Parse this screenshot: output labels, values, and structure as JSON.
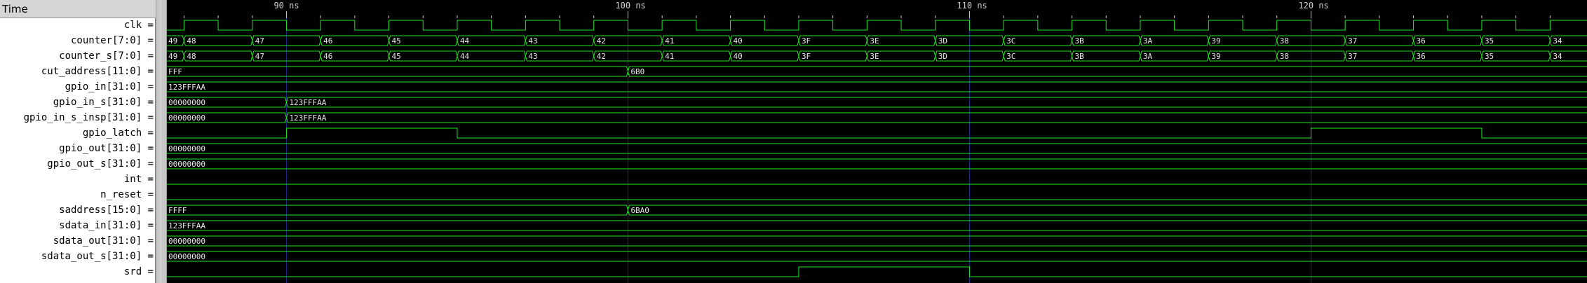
{
  "time_header": "Time",
  "time_ticks": [
    {
      "t": 90,
      "label": "90 ns"
    },
    {
      "t": 100,
      "label": "100 ns"
    },
    {
      "t": 110,
      "label": "110 ns"
    },
    {
      "t": 120,
      "label": "120 ns"
    }
  ],
  "view": {
    "t_start": 86.5,
    "t_end": 127.6
  },
  "colors": {
    "trace": "#22e622",
    "grid": "#1e2a8a",
    "tick": "#c8c8c8",
    "text": "#e8e8e8"
  },
  "signals": [
    {
      "name": "clk",
      "kind": "clock",
      "period": 2,
      "high_start": 87,
      "t_end": 127.6
    },
    {
      "name": "counter[7:0]",
      "kind": "counter",
      "start_value": 73,
      "first_change": 87,
      "step": 2,
      "radix": "hex",
      "t_end": 127.6
    },
    {
      "name": "counter_s[7:0]",
      "kind": "counter",
      "start_value": 73,
      "first_change": 87,
      "step": 2,
      "radix": "hex",
      "t_end": 127.6
    },
    {
      "name": "cut_address[11:0]",
      "kind": "bus",
      "segments": [
        {
          "t": 86.5,
          "v": "FFF"
        },
        {
          "t": 100,
          "v": "6B0"
        }
      ]
    },
    {
      "name": "gpio_in[31:0]",
      "kind": "bus",
      "segments": [
        {
          "t": 86.5,
          "v": "123FFFAA"
        }
      ]
    },
    {
      "name": "gpio_in_s[31:0]",
      "kind": "bus",
      "segments": [
        {
          "t": 86.5,
          "v": "00000000"
        },
        {
          "t": 90,
          "v": "123FFFAA"
        }
      ]
    },
    {
      "name": "gpio_in_s_insp[31:0]",
      "kind": "bus",
      "segments": [
        {
          "t": 86.5,
          "v": "00000000"
        },
        {
          "t": 90,
          "v": "123FFFAA"
        }
      ]
    },
    {
      "name": "gpio_latch",
      "kind": "bit",
      "initial": 0,
      "edges": [
        90,
        95,
        120,
        125
      ]
    },
    {
      "name": "gpio_out[31:0]",
      "kind": "bus",
      "segments": [
        {
          "t": 86.5,
          "v": "00000000"
        }
      ]
    },
    {
      "name": "gpio_out_s[31:0]",
      "kind": "bus",
      "segments": [
        {
          "t": 86.5,
          "v": "00000000"
        }
      ]
    },
    {
      "name": "int",
      "kind": "bit",
      "initial": 0,
      "edges": []
    },
    {
      "name": "n_reset",
      "kind": "bit",
      "initial": 0,
      "edges": []
    },
    {
      "name": "saddress[15:0]",
      "kind": "bus",
      "segments": [
        {
          "t": 86.5,
          "v": "FFFF"
        },
        {
          "t": 100,
          "v": "6BA0"
        }
      ]
    },
    {
      "name": "sdata_in[31:0]",
      "kind": "bus",
      "segments": [
        {
          "t": 86.5,
          "v": "123FFFAA"
        }
      ]
    },
    {
      "name": "sdata_out[31:0]",
      "kind": "bus",
      "segments": [
        {
          "t": 86.5,
          "v": "00000000"
        }
      ]
    },
    {
      "name": "sdata_out_s[31:0]",
      "kind": "bus",
      "segments": [
        {
          "t": 86.5,
          "v": "00000000"
        }
      ]
    },
    {
      "name": "srd",
      "kind": "bit",
      "initial": 0,
      "edges": [
        105,
        110
      ]
    }
  ]
}
